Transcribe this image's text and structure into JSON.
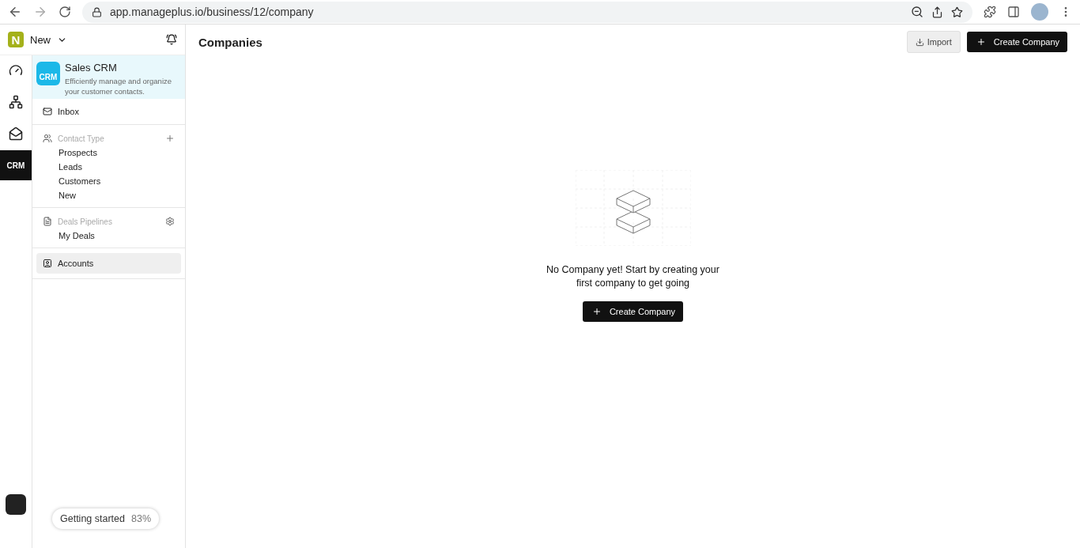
{
  "browser": {
    "url": "app.manageplus.io/business/12/company"
  },
  "workspace": {
    "logo": "N",
    "name": "New"
  },
  "rail": [
    {
      "kind": "dashboard",
      "selected": false
    },
    {
      "kind": "network",
      "selected": false
    },
    {
      "kind": "mail",
      "selected": false
    },
    {
      "kind": "crm",
      "label": "CRM",
      "selected": true
    }
  ],
  "app_card": {
    "logo": "CRM",
    "title": "Sales CRM",
    "description": "Efficiently manage and organize your customer contacts."
  },
  "sidebar": {
    "inbox": {
      "label": "Inbox",
      "selected": false
    },
    "contact_type": {
      "title": "Contact Type",
      "items": [
        {
          "label": "Prospects",
          "selected": false
        },
        {
          "label": "Leads",
          "selected": false
        },
        {
          "label": "Customers",
          "selected": false
        },
        {
          "label": "New",
          "selected": false
        }
      ]
    },
    "deals": {
      "title": "Deals Pipelines",
      "items": [
        {
          "label": "My Deals",
          "selected": false
        }
      ]
    },
    "accounts": {
      "label": "Accounts",
      "selected": true
    }
  },
  "getting_started": {
    "label": "Getting started",
    "percent": "83%"
  },
  "page": {
    "title": "Companies",
    "import_button": "Import",
    "create_button": "Create Company"
  },
  "empty_state": {
    "message": "No Company yet! Start by creating your first company to get going",
    "button": "Create Company"
  }
}
